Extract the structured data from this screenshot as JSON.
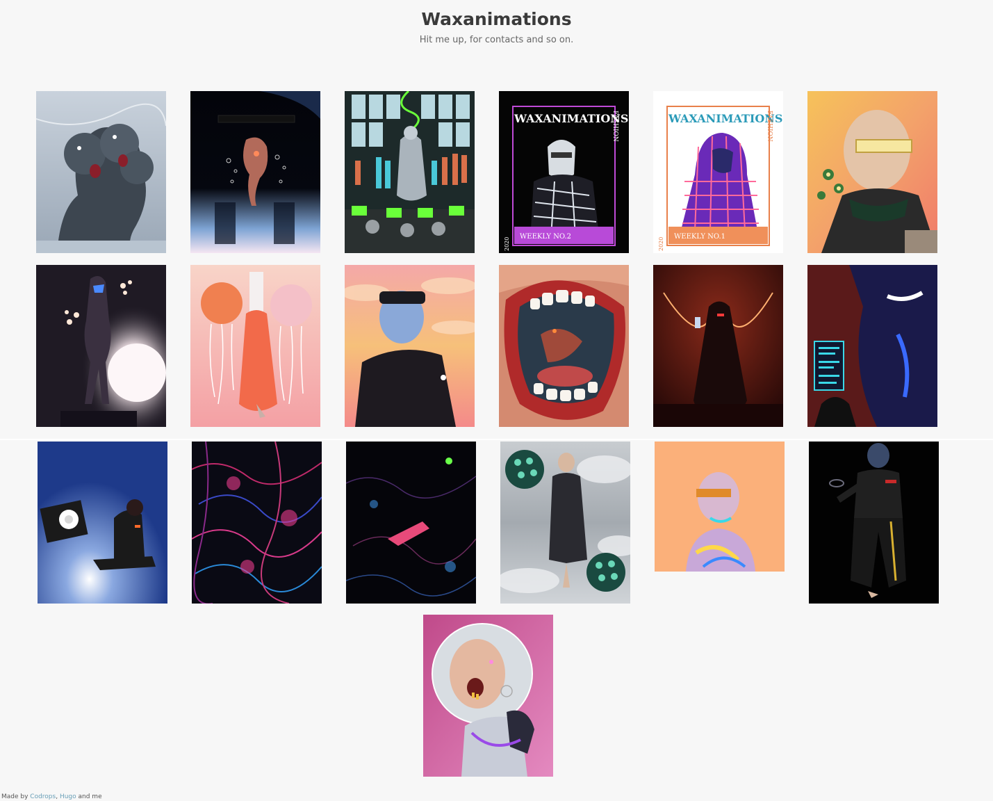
{
  "header": {
    "title": "Waxanimations",
    "subtitle": "Hit me up, for contacts and so on."
  },
  "gallery": {
    "items": [
      {
        "name": "gallery-item-marble-heads",
        "icon": "artwork-image"
      },
      {
        "name": "gallery-item-floating-figure",
        "icon": "artwork-image"
      },
      {
        "name": "gallery-item-lab-robots",
        "icon": "artwork-image"
      },
      {
        "name": "gallery-item-cover-weekly-2",
        "icon": "artwork-image",
        "cover_title": "WAXANIMATIONS",
        "cover_side": "FASHION",
        "cover_issue": "WEEKLY NO.2",
        "cover_year": "2020"
      },
      {
        "name": "gallery-item-cover-weekly-1",
        "icon": "artwork-image",
        "cover_title": "WAXANIMATIONS",
        "cover_side": "FASHION",
        "cover_issue": "WEEKLY NO.1",
        "cover_year": "2020"
      },
      {
        "name": "gallery-item-visor-flowers",
        "icon": "artwork-image"
      },
      {
        "name": "gallery-item-chrome-statue",
        "icon": "artwork-image"
      },
      {
        "name": "gallery-item-jellyfish",
        "icon": "artwork-image"
      },
      {
        "name": "gallery-item-beanie-sky",
        "icon": "artwork-image"
      },
      {
        "name": "gallery-item-mouth",
        "icon": "artwork-image"
      },
      {
        "name": "gallery-item-cloak-red",
        "icon": "artwork-image"
      },
      {
        "name": "gallery-item-target-sign",
        "icon": "artwork-image"
      },
      {
        "name": "gallery-item-tv-sitting",
        "icon": "artwork-image"
      },
      {
        "name": "gallery-item-fractal-1",
        "icon": "artwork-image"
      },
      {
        "name": "gallery-item-fractal-2",
        "icon": "artwork-image"
      },
      {
        "name": "gallery-item-sphere-clouds",
        "icon": "artwork-image"
      },
      {
        "name": "gallery-item-chrome-bust",
        "icon": "artwork-image"
      },
      {
        "name": "gallery-item-hoodie-dark",
        "icon": "artwork-image"
      },
      {
        "name": "gallery-item-open-mouth-bald",
        "icon": "artwork-image"
      }
    ]
  },
  "footer": {
    "prefix": "Made by ",
    "link_codrops": "Codrops",
    "sep": ", ",
    "link_hugo": "Hugo",
    "suffix": " and me"
  },
  "colors": {
    "background": "#f7f7f7",
    "title": "#3a3a3a",
    "link": "#6aa0b8"
  }
}
